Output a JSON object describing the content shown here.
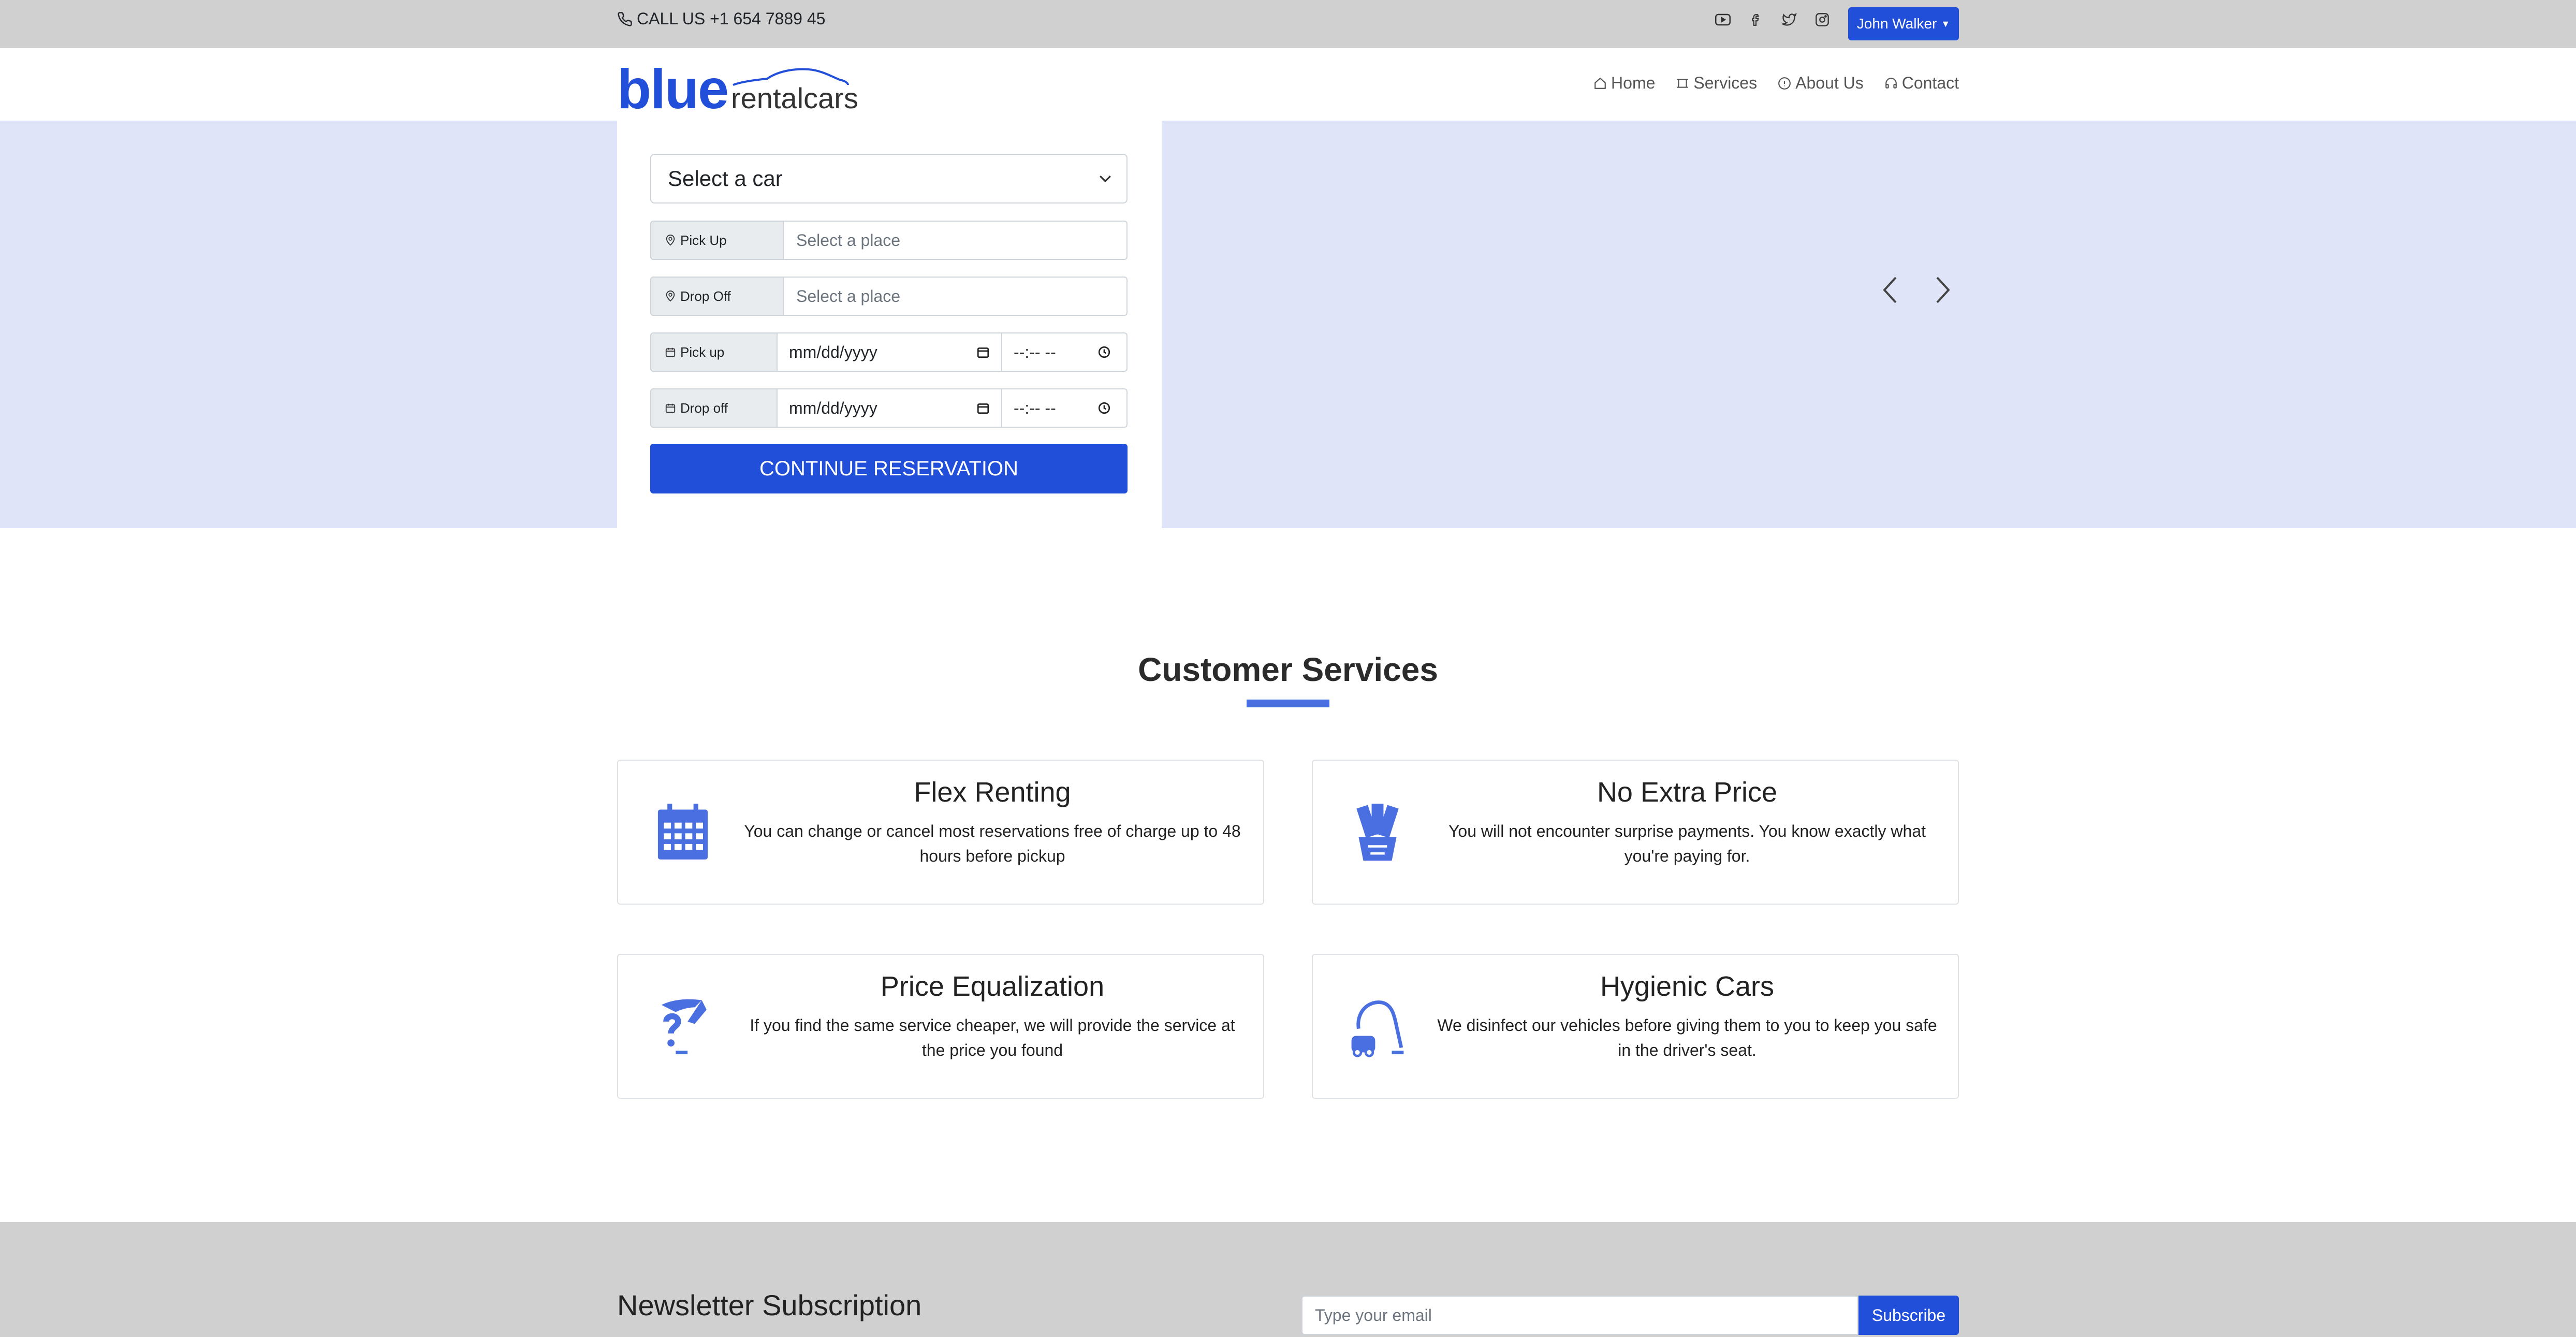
{
  "topbar": {
    "call_text": "CALL US +1 654 7889 45",
    "social_icons": [
      "youtube-icon",
      "facebook-icon",
      "twitter-icon",
      "instagram-icon"
    ],
    "user_button": "John Walker"
  },
  "header": {
    "logo_bold": "blue",
    "logo_light": "rentalcars",
    "nav": [
      {
        "label": "Home",
        "icon": "home-icon"
      },
      {
        "label": "Services",
        "icon": "services-icon"
      },
      {
        "label": "About Us",
        "icon": "info-icon"
      },
      {
        "label": "Contact",
        "icon": "headset-icon"
      }
    ]
  },
  "reservation": {
    "car_select": "Select a car",
    "pickup_place_label": "Pick Up",
    "pickup_place_placeholder": "Select a place",
    "dropoff_place_label": "Drop Off",
    "dropoff_place_placeholder": "Select a place",
    "pickup_date_label": "Pick up",
    "dropoff_date_label": "Drop off",
    "date_placeholder": "mm/dd/yyyy",
    "time_placeholder": "--:-- --",
    "continue_button": "CONTINUE RESERVATION"
  },
  "services": {
    "title": "Customer Services",
    "cards": [
      {
        "title": "Flex Renting",
        "text": "You can change or cancel most reservations free of charge up to 48 hours before pickup",
        "icon": "calendar-icon"
      },
      {
        "title": "No Extra Price",
        "text": "You will not encounter surprise payments. You know exactly what you're paying for.",
        "icon": "money-icon"
      },
      {
        "title": "Price Equalization",
        "text": "If you find the same service cheaper, we will provide the service at the price you found",
        "icon": "question-hand-icon"
      },
      {
        "title": "Hygienic Cars",
        "text": "We disinfect our vehicles before giving them to you to keep you safe in the driver's seat.",
        "icon": "vacuum-icon"
      }
    ]
  },
  "newsletter": {
    "title": "Newsletter Subscription",
    "email_placeholder": "Type your email",
    "subscribe_button": "Subscribe"
  },
  "colors": {
    "accent": "#224fd9",
    "hero_bg": "#dfe4f8",
    "topbar_bg": "#d0d0d0"
  }
}
